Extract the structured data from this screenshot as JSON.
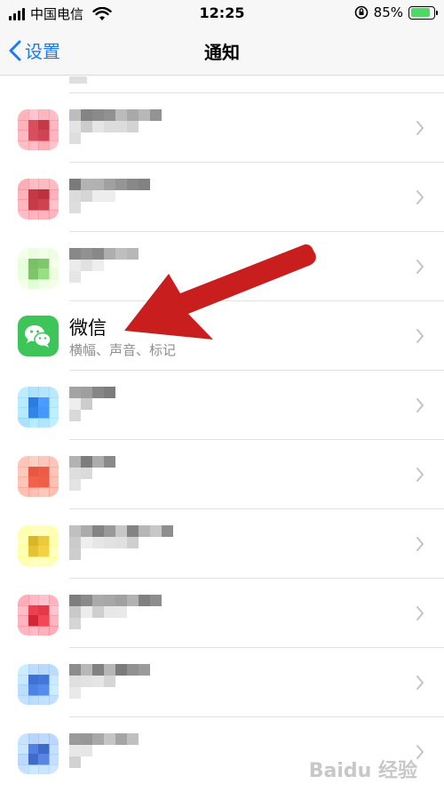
{
  "status_bar": {
    "carrier": "中国电信",
    "time": "12:25",
    "battery_percent": "85%",
    "battery_level": 0.85
  },
  "nav": {
    "back_label": "设置",
    "title": "通知"
  },
  "rows": [
    {
      "name": "blurred-app-1",
      "icon_color": "#c63c4a"
    },
    {
      "name": "blurred-app-2",
      "icon_color": "#c43a47"
    },
    {
      "name": "blurred-app-3",
      "icon_color": "#8ed47b"
    },
    {
      "name": "wechat",
      "title": "微信",
      "subtitle": "横幅、声音、标记",
      "icon_color": "#34c759"
    },
    {
      "name": "blurred-app-5",
      "icon_color": "#3b8ef0"
    },
    {
      "name": "blurred-app-6",
      "icon_color": "#e4533d"
    },
    {
      "name": "blurred-app-7",
      "icon_color": "#e6c536"
    },
    {
      "name": "blurred-app-8",
      "icon_color": "#e63a4b"
    },
    {
      "name": "blurred-app-9",
      "icon_color": "#4a7fe0"
    },
    {
      "name": "blurred-app-10",
      "icon_color": "#4b78d6"
    }
  ],
  "colors": {
    "accent": "#1a7cf5",
    "annotation_arrow": "#c81e1e"
  },
  "watermark": "Baidu 经验"
}
